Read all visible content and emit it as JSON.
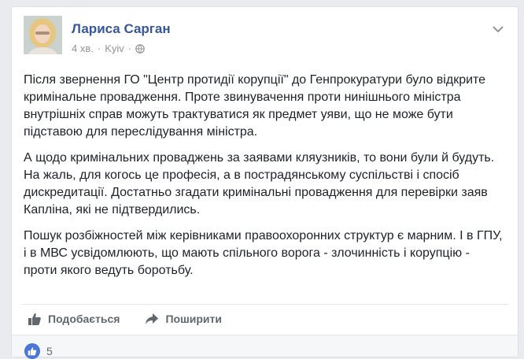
{
  "post": {
    "author": "Лариса Сарган",
    "time": "4 хв.",
    "separator": "·",
    "location": "Kyiv",
    "location_separator": "·",
    "paragraphs": [
      "Після звернення ГО \"Центр протидії корупції\" до Генпрокуратури було відкрите кримінальне провадження. Проте звинувачення проти нинішнього міністра внутрішніх справ можуть трактуватися як предмет уяви, що не може бути підставою для переслідування міністра.",
      "А щодо кримінальних проваджень за заявами кляузників, то вони були й будуть. На жаль, для когось це професія, а в пострадянському суспільстві і спосіб дискредитації. Достатньо згадати кримінальні провадження для перевірки заяв Капліна, які не підтвердились.",
      "Пошук розбіжностей між керівниками правоохоронних структур є марним. І в ГПУ, і в МВС усвідомлюють, що мають спільного ворога - злочинність і корупцію - проти якого ведуть боротьбу."
    ]
  },
  "actions": {
    "like_label": "Подобається",
    "share_label": "Поширити"
  },
  "reactions": {
    "count": "5"
  },
  "colors": {
    "author": "#365899",
    "meta": "#90949c",
    "action": "#606770",
    "like_badge": "#4a76d8"
  },
  "icons": {
    "like": "thumbs-up-icon",
    "share": "share-arrow-icon",
    "globe": "globe-icon",
    "menu": "chevron-down-icon"
  }
}
